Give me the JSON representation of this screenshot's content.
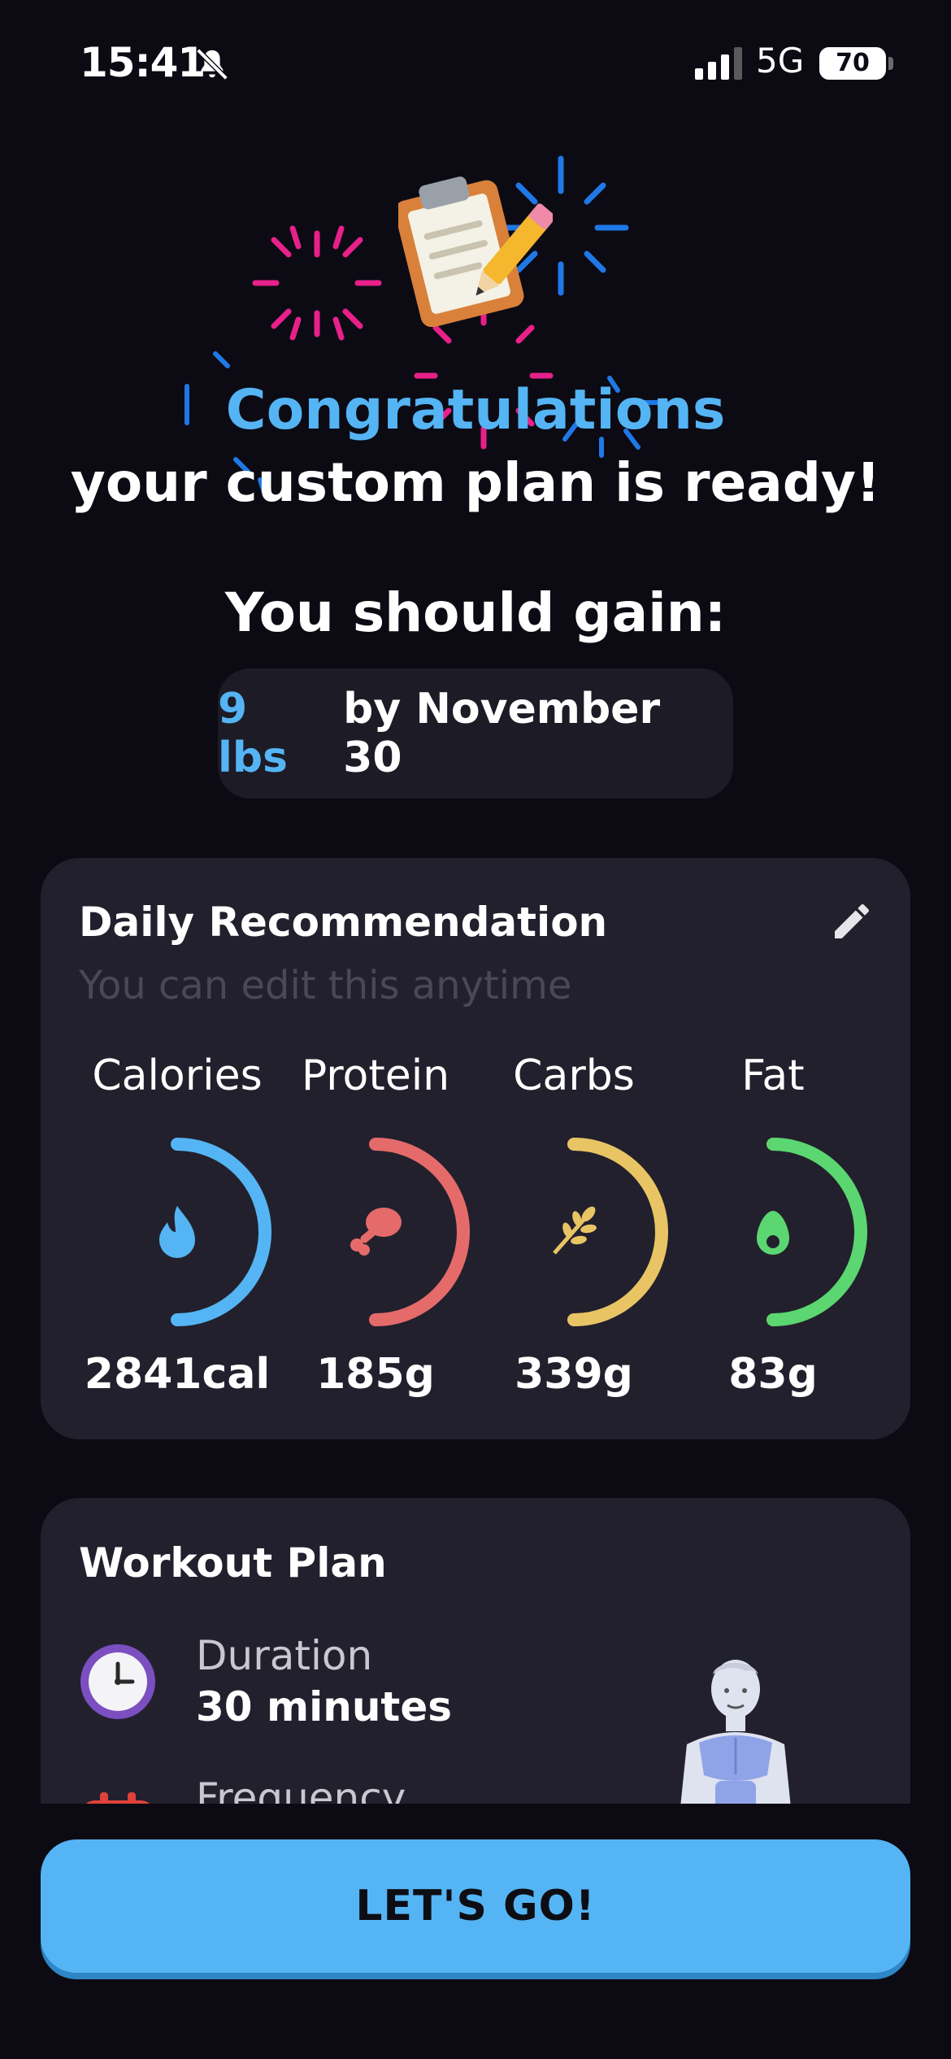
{
  "status_bar": {
    "time": "15:41",
    "network": "5G",
    "battery": "70"
  },
  "header": {
    "title_line1": "Congratulations",
    "title_line2": "your custom plan is ready!",
    "gain_heading": "You should gain:",
    "gain_amount": "9 lbs",
    "gain_date": "by November 30"
  },
  "daily": {
    "title": "Daily Recommendation",
    "subtitle": "You can edit this anytime",
    "macros": [
      {
        "label": "Calories",
        "value": "2841cal",
        "color": "#55b4f3",
        "icon": "flame-icon"
      },
      {
        "label": "Protein",
        "value": "185g",
        "color": "#e56b6b",
        "icon": "drumstick-icon"
      },
      {
        "label": "Carbs",
        "value": "339g",
        "color": "#e9c464",
        "icon": "wheat-icon"
      },
      {
        "label": "Fat",
        "value": "83g",
        "color": "#5bd671",
        "icon": "avocado-icon"
      }
    ]
  },
  "workout": {
    "title": "Workout Plan",
    "duration_label": "Duration",
    "duration_value": "30 minutes",
    "frequency_label": "Frequency"
  },
  "cta": {
    "label": "LET'S GO!"
  },
  "colors": {
    "accent": "#55b4f3",
    "background": "#0c0b14",
    "card": "#22202d"
  }
}
